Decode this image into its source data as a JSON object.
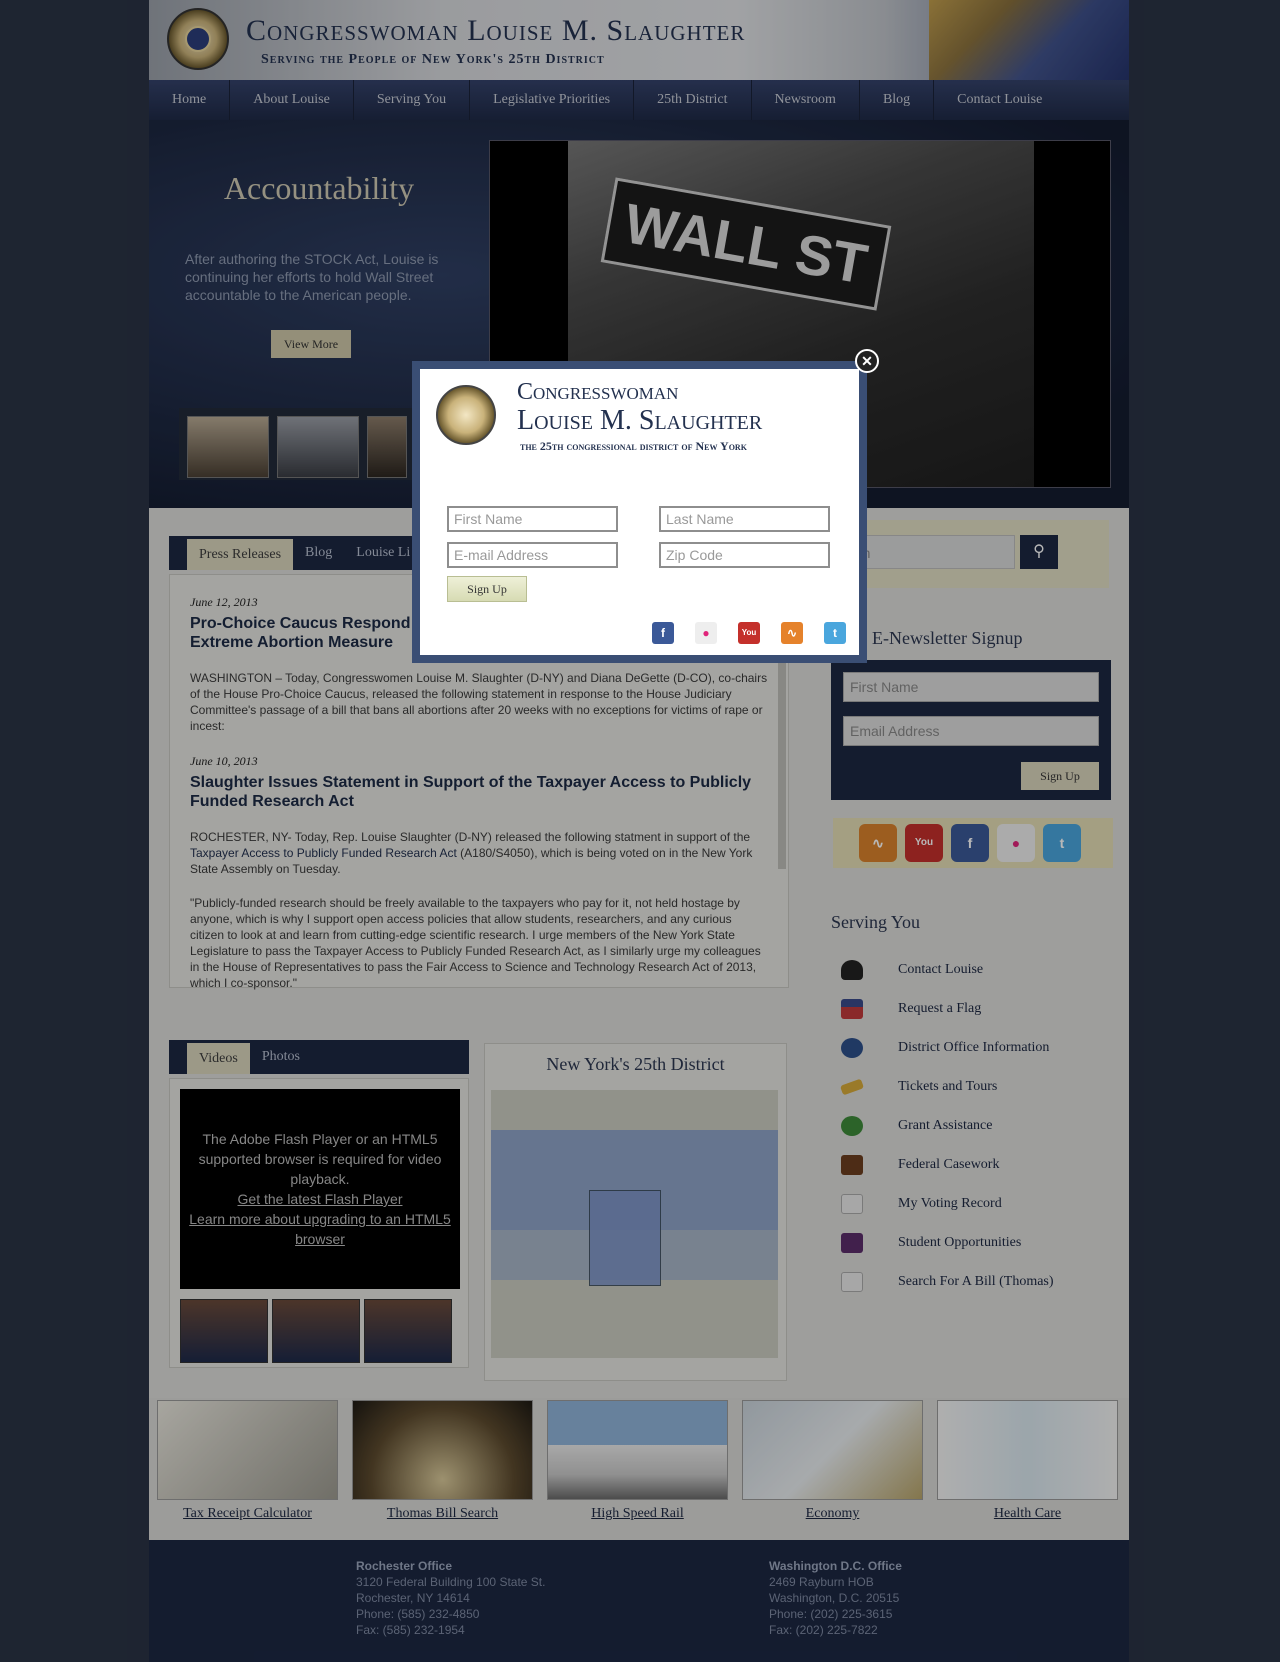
{
  "header": {
    "title": "Congresswoman Louise M. Slaughter",
    "subtitle": "Serving the People of New York's 25th District"
  },
  "nav": [
    "Home",
    "About Louise",
    "Serving You",
    "Legislative Priorities",
    "25th District",
    "Newsroom",
    "Blog",
    "Contact Louise"
  ],
  "hero": {
    "title": "Accountability",
    "text": "After authoring the STOCK Act, Louise is continuing her efforts to hold Wall Street accountable to the American people.",
    "button": "View More",
    "image_sign": "WALL ST"
  },
  "news_tabs": [
    "Press Releases",
    "Blog",
    "Louise Li"
  ],
  "articles": [
    {
      "date": "June 12, 2013",
      "title": "Pro-Choice Caucus Respond\nExtreme Abortion Measure",
      "body": "WASHINGTON – Today, Congresswomen Louise M. Slaughter (D-NY) and Diana DeGette (D-CO), co-chairs of the House Pro-Choice Caucus, released the following statement in response to the House Judiciary Committee's passage of a bill that bans all abortions after 20 weeks with no exceptions for victims of rape or incest:"
    },
    {
      "date": "June 10, 2013",
      "title": "Slaughter Issues Statement in Support of the Taxpayer Access to Publicly Funded Research Act",
      "body_pre": "ROCHESTER, NY- Today, Rep. Louise Slaughter (D-NY) released the following statment in support of the ",
      "body_link": "Taxpayer Access to Publicly Funded Research Act",
      "body_post": " (A180/S4050), which is being voted on in the New York State Assembly on Tuesday.",
      "quote": "\"Publicly-funded research should be freely available to the taxpayers who pay for it, not held hostage by anyone, which is why I support open access policies that allow students, researchers, and any curious citizen to look at and learn from cutting-edge scientific research. I urge members of the New York State Legislature to pass the Taxpayer Access to Publicly Funded Research Act, as I similarly urge my colleagues in the House of Representatives to pass the Fair Access to Science and Technology Research Act of 2013, which I co-sponsor.\""
    }
  ],
  "media_tabs": [
    "Videos",
    "Photos"
  ],
  "video": {
    "message": "The Adobe Flash Player or an HTML5 supported browser is required for video playback.",
    "link1": "Get the latest Flash Player",
    "link2": "Learn more about upgrading to an HTML5 browser"
  },
  "map": {
    "title": "New York's 25th District"
  },
  "search": {
    "placeholder": "Search"
  },
  "newsletter": {
    "title": "se Line E-Newsletter Signup",
    "first_placeholder": "First Name",
    "email_placeholder": "Email Address",
    "button": "Sign Up"
  },
  "serving": {
    "title": "Serving You",
    "items": [
      "Contact Louise",
      "Request a Flag",
      "District Office Information",
      "Tickets and Tours",
      "Grant Assistance",
      "Federal Casework",
      "My Voting Record",
      "Student Opportunities",
      "Search For A Bill (Thomas)"
    ]
  },
  "promos": [
    "Tax Receipt Calculator",
    "Thomas Bill Search",
    "High Speed Rail",
    "Economy",
    "Health Care"
  ],
  "footer": {
    "rochester": {
      "name": "Rochester Office",
      "line1": "3120 Federal Building 100 State St.",
      "line2": "Rochester, NY 14614",
      "phone": "Phone: (585) 232-4850",
      "fax": "Fax: (585) 232-1954"
    },
    "dc": {
      "name": "Washington D.C. Office",
      "line1": "2469 Rayburn HOB",
      "line2": "Washington, D.C. 20515",
      "phone": "Phone: (202) 225-3615",
      "fax": "Fax: (202) 225-7822"
    }
  },
  "modal": {
    "title1": "Congresswoman",
    "title2": "Louise M. Slaughter",
    "subtitle": "the 25th congressional district of New York",
    "first_placeholder": "First Name",
    "last_placeholder": "Last Name",
    "email_placeholder": "E-mail Address",
    "zip_placeholder": "Zip Code",
    "button": "Sign Up",
    "close": "✕"
  },
  "colors": {
    "navy": "#1c2742",
    "accent": "#d8d4bc"
  }
}
